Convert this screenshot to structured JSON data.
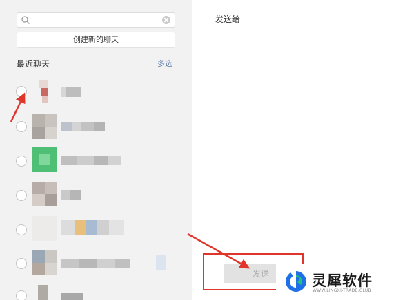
{
  "search": {
    "value": "",
    "placeholder": ""
  },
  "new_chat_button": "创建新的聊天",
  "recent_section": {
    "title": "最近聊天",
    "multi_select": "多选"
  },
  "right_panel": {
    "send_to_label": "发送给",
    "send_button": "发送"
  },
  "watermark": {
    "title": "灵犀软件",
    "subtitle": "WWW.LINGXI-TRADE.CLUB"
  },
  "colors": {
    "annotation_red": "#e0352b",
    "link_blue": "#5a7ca8",
    "panel_gray": "#f2f2f2",
    "logo_blue": "#1e6fe8",
    "logo_green": "#22c27a"
  },
  "icons": [
    "search-icon",
    "clear-icon",
    "arrow-annotation-icon",
    "brand-logo-icon"
  ]
}
